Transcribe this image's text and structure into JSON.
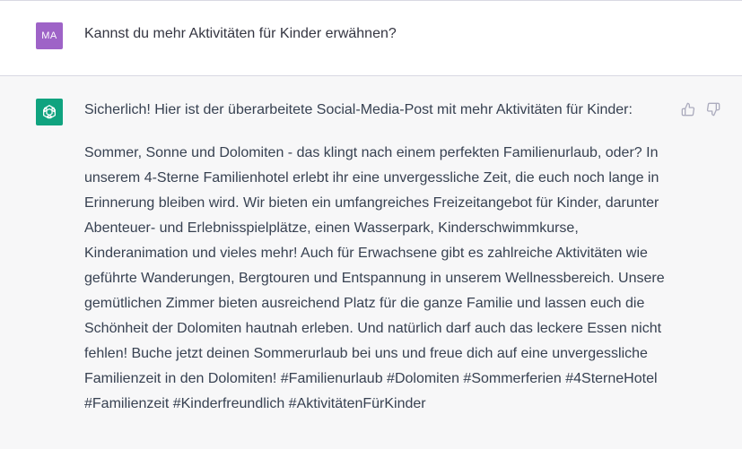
{
  "conversation": {
    "user_message": {
      "avatar_initials": "MA",
      "avatar_color": "#9e63c7",
      "text": "Kannst du mehr Aktivitäten für Kinder erwähnen?"
    },
    "assistant_message": {
      "avatar_icon": "openai-logo-icon",
      "avatar_color": "#10a37f",
      "intro": "Sicherlich! Hier ist der überarbeitete Social-Media-Post mit mehr Aktivitäten für Kinder:",
      "body": "Sommer, Sonne und Dolomiten - das klingt nach einem perfekten Familienurlaub, oder? In unserem 4-Sterne Familienhotel erlebt ihr eine unvergessliche Zeit, die euch noch lange in Erinnerung bleiben wird. Wir bieten ein umfangreiches Freizeitangebot für Kinder, darunter Abenteuer- und Erlebnisspielplätze, einen Wasserpark, Kinderschwimmkurse, Kinderanimation und vieles mehr! Auch für Erwachsene gibt es zahlreiche Aktivitäten wie geführte Wanderungen, Bergtouren und Entspannung in unserem Wellnessbereich. Unsere gemütlichen Zimmer bieten ausreichend Platz für die ganze Familie und lassen euch die Schönheit der Dolomiten hautnah erleben. Und natürlich darf auch das leckere Essen nicht fehlen! Buche jetzt deinen Sommerurlaub bei uns und freue dich auf eine unvergessliche Familienzeit in den Dolomiten! #Familienurlaub #Dolomiten #Sommerferien #4SterneHotel #Familienzeit #Kinderfreundlich #AktivitätenFürKinder",
      "feedback": {
        "thumbs_up_icon": "thumbs-up-icon",
        "thumbs_down_icon": "thumbs-down-icon"
      }
    }
  }
}
